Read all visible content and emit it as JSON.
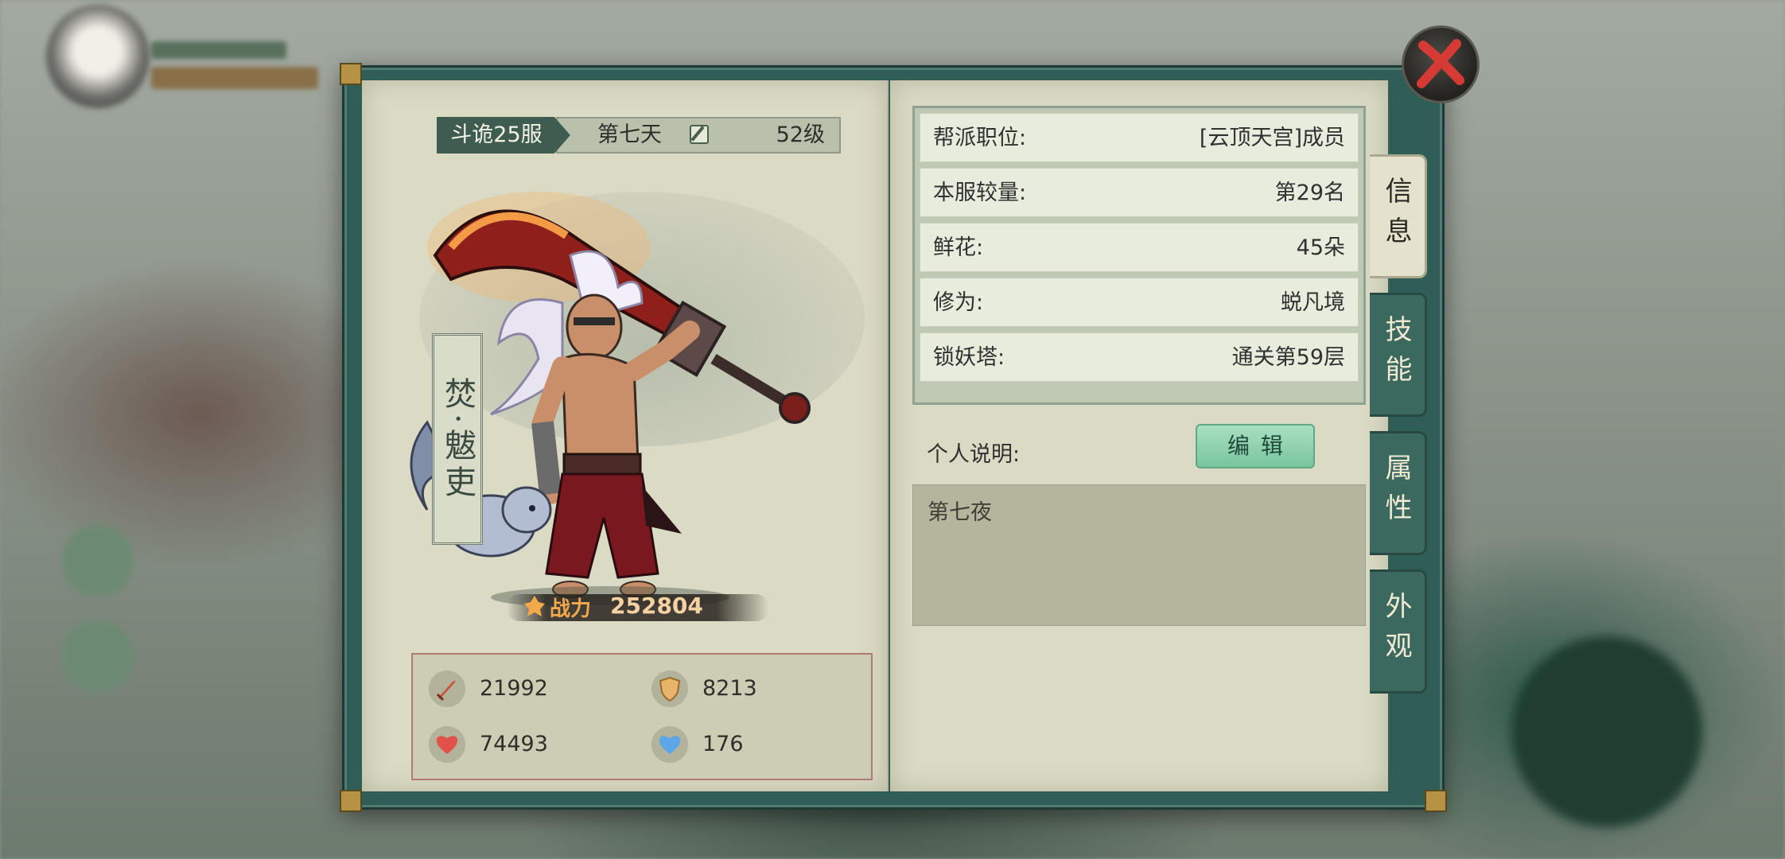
{
  "banner": {
    "server": "斗诡25服",
    "day": "第七天",
    "level": "52级"
  },
  "character": {
    "name": "焚·魃吏",
    "power_label": "战力",
    "power_value": "252804"
  },
  "stats": [
    {
      "icon": "sword-icon",
      "value": "21992",
      "color": "#c9573f"
    },
    {
      "icon": "shield-icon",
      "value": "8213",
      "color": "#e8b46a"
    },
    {
      "icon": "heart-icon",
      "value": "74493",
      "color": "#e2524a"
    },
    {
      "icon": "heart-icon",
      "value": "176",
      "color": "#5ba7e8"
    }
  ],
  "info": [
    {
      "key": "帮派职位:",
      "value": "[云顶天宫]成员"
    },
    {
      "key": "本服较量:",
      "value": "第29名"
    },
    {
      "key": "鲜花:",
      "value": "45朵"
    },
    {
      "key": "修为:",
      "value": "蜕凡境"
    },
    {
      "key": "锁妖塔:",
      "value": "通关第59层"
    }
  ],
  "description": {
    "label": "个人说明:",
    "edit_label": "编辑",
    "text": "第七夜"
  },
  "tabs": [
    {
      "label": "信息",
      "active": true
    },
    {
      "label": "技能",
      "active": false
    },
    {
      "label": "属性",
      "active": false
    },
    {
      "label": "外观",
      "active": false
    }
  ],
  "colors": {
    "frame": "#2f5e56",
    "page": "#dadac5",
    "accent_button": "#79c5a0",
    "close_x": "#d63a35"
  }
}
